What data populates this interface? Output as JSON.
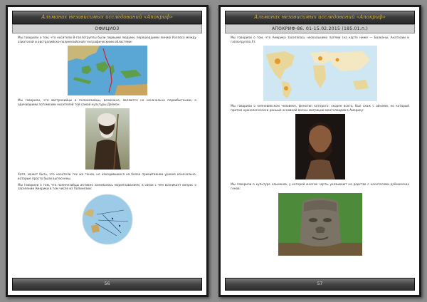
{
  "left_page": {
    "header_title": "Альманах независимых исследований «Апокриф»",
    "subheader": "ОФИЦИОЗ",
    "paragraphs": [
      "Мы говорили о том, что носители В-гаплогруппы были первыми людьми, перешедшими линию Уоллеса между азиатской и австралийско-полинезийской географическими областями:",
      "Мы говорили, что австралийцы и полинезийцы, возможно, являются не изначально первобытными, а одичавшими потомками носителей той самой культуры Дзёмон:",
      "Хотя, может быть, это носители тех же генов, но находившиеся на более примитивном уровне изначально, которые просто были вытеснены.",
      "Мы говорили о том, что полинезийцы активно занимались мореплаванием, в связи с чем возникает вопрос о заселении Америки в том числе из Полинезии:"
    ],
    "page_number": "56"
  },
  "right_page": {
    "header_title": "Альманах независимых исследований «Апокриф»",
    "subheader": "АПОКРИФ-86. 01-15.02.2015 (185.01.п.)",
    "paragraphs": [
      "Мы говорили о том, что Америка заселялась несколькими путями (на карте ниже — Балканы, Анатолии и гаплогруппа X):",
      "Мы говорили о кенневикском человеке, фенотип которого, скорее всего, был схож с айнами, но который притом хронологически раньше основной волны миграции монголоидов в Америку:",
      "Мы говорили о культуре ольмеков, у которой многие черты указывают на родство с носителями дзёмонских генов:"
    ],
    "page_number": "57"
  },
  "icons": {
    "logo": "apocrypha-logo-icon"
  },
  "colors": {
    "header_text": "#d4b44a",
    "logo": "#c0392b",
    "background": "#8e8e8e"
  }
}
